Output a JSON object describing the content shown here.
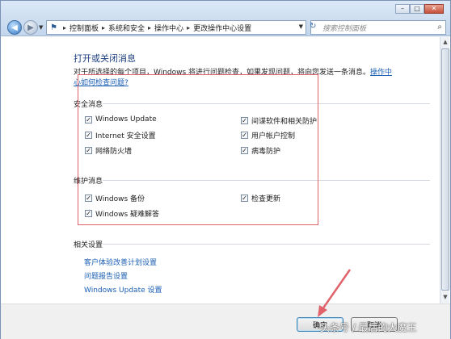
{
  "window": {
    "controls": [
      "–",
      "□",
      "✕"
    ]
  },
  "nav": {
    "breadcrumbs": [
      "控制面板",
      "系统和安全",
      "操作中心",
      "更改操作中心设置"
    ],
    "search_placeholder": "搜索控制面板"
  },
  "main": {
    "title": "打开或关闭消息",
    "intro_text": "对于所选择的每个项目，Windows 将进行问题检查，如果发现问题，将向您发送一条消息。",
    "intro_link": "操作中心如何检查问题?",
    "security_section": {
      "heading": "安全消息",
      "items": [
        {
          "label": "Windows Update",
          "checked": true
        },
        {
          "label": "间谍软件和相关防护",
          "checked": true
        },
        {
          "label": "Internet 安全设置",
          "checked": true
        },
        {
          "label": "用户帐户控制",
          "checked": true
        },
        {
          "label": "网络防火墙",
          "checked": true
        },
        {
          "label": "病毒防护",
          "checked": true
        }
      ]
    },
    "maintenance_section": {
      "heading": "维护消息",
      "items": [
        {
          "label": "Windows 备份",
          "checked": true
        },
        {
          "label": "检查更新",
          "checked": true
        },
        {
          "label": "Windows 疑难解答",
          "checked": true
        }
      ]
    },
    "related_section": {
      "heading": "相关设置",
      "links": [
        "客户体验改善计划设置",
        "问题报告设置",
        "Windows Update 设置"
      ]
    }
  },
  "footer": {
    "ok_label": "确定",
    "cancel_label": "取消"
  },
  "watermark": "头条号 / 最后的大魔王",
  "colors": {
    "highlight": "#e0626a",
    "link": "#1a5fb4",
    "title": "#1c3e80"
  }
}
